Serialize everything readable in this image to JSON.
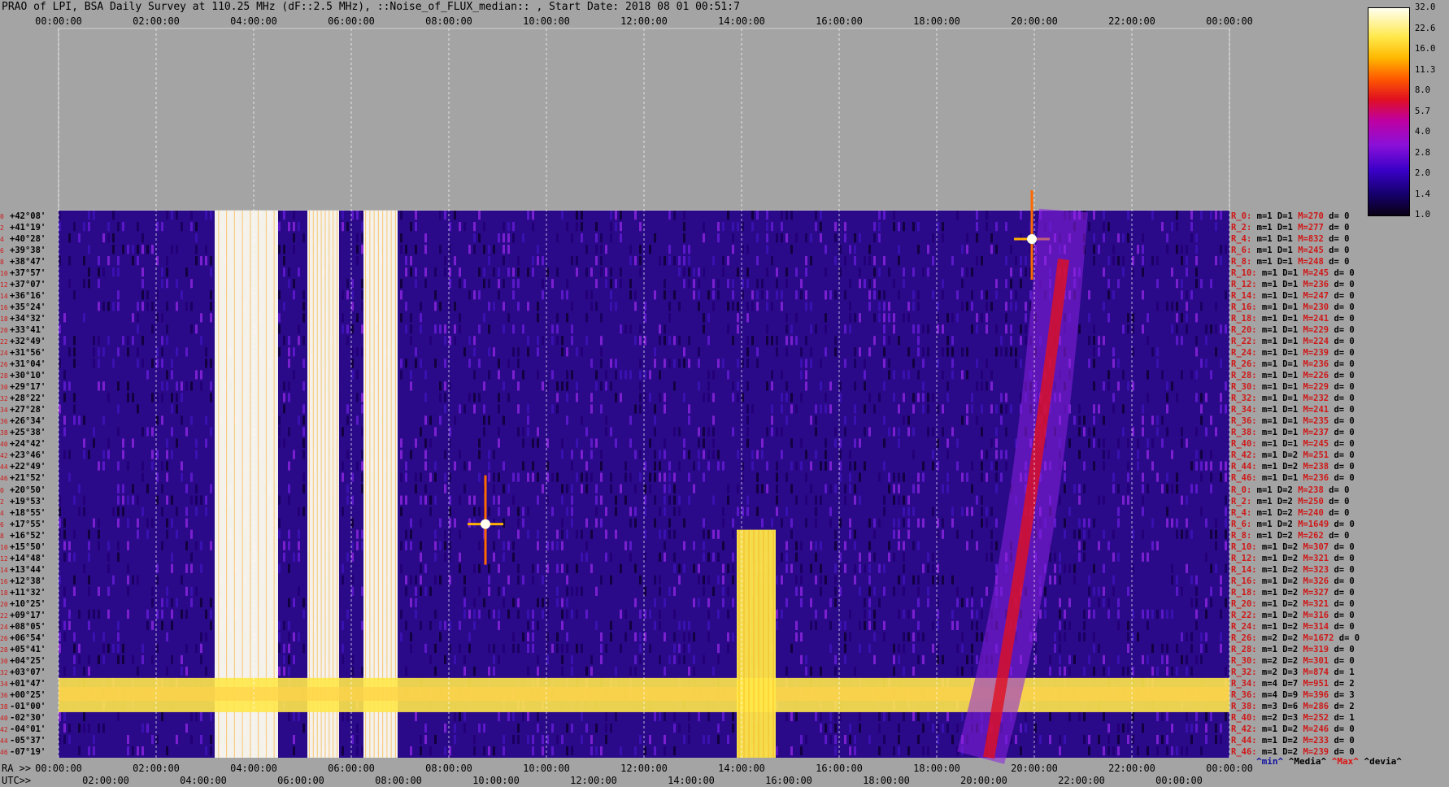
{
  "title": "PRAO of LPI, BSA Daily Survey at 110.25 MHz (dF::2.5 MHz), ::Noise_of_FLUX_median:: , Start Date: 2018 08 01 00:51:7",
  "chart_data": {
    "type": "heatmap",
    "title": "PRAO of LPI, BSA Daily Survey at 110.25 MHz (dF::2.5 MHz), ::Noise_of_FLUX_median:: , Start Date: 2018 08 01 00:51:7",
    "x_top_ticks": [
      "00:00:00",
      "02:00:00",
      "04:00:00",
      "06:00:00",
      "08:00:00",
      "10:00:00",
      "12:00:00",
      "14:00:00",
      "16:00:00",
      "18:00:00",
      "20:00:00",
      "22:00:00",
      "00:00:00"
    ],
    "x_ra_ticks": [
      "00:00:00",
      "02:00:00",
      "04:00:00",
      "06:00:00",
      "08:00:00",
      "10:00:00",
      "12:00:00",
      "14:00:00",
      "16:00:00",
      "18:00:00",
      "20:00:00",
      "22:00:00",
      "00:00:00"
    ],
    "x_utc_ticks": [
      "02:00:00",
      "04:00:00",
      "06:00:00",
      "08:00:00",
      "10:00:00",
      "12:00:00",
      "14:00:00",
      "16:00:00",
      "18:00:00",
      "20:00:00",
      "22:00:00",
      "00:00:00"
    ],
    "x_ra_prefix": "RA >>",
    "x_utc_prefix": "UTC>>",
    "dec_labels": [
      "+42°08'",
      "+41°19'",
      "+40°28'",
      "+39°38'",
      "+38°47'",
      "+37°57'",
      "+37°07'",
      "+36°16'",
      "+35°24'",
      "+34°32'",
      "+33°41'",
      "+32°49'",
      "+31°56'",
      "+31°04'",
      "+30°10'",
      "+29°17'",
      "+28°22'",
      "+27°28'",
      "+26°34'",
      "+25°38'",
      "+24°42'",
      "+23°46'",
      "+22°49'",
      "+21°52'",
      "+20°50'",
      "+19°53'",
      "+18°55'",
      "+17°55'",
      "+16°52'",
      "+15°50'",
      "+14°48'",
      "+13°44'",
      "+12°38'",
      "+11°32'",
      "+10°25'",
      "+09°17'",
      "+08°05'",
      "+06°54'",
      "+05°41'",
      "+04°25'",
      "+03°07'",
      "+01°47'",
      "+00°25'",
      "-01°00'",
      "-02°30'",
      "-04°01'",
      "-05°37'",
      "-07°19'"
    ],
    "dec_index_labels": [
      "0",
      "2",
      "4",
      "6",
      "8",
      "10",
      "12",
      "14",
      "16",
      "18",
      "20",
      "22",
      "24",
      "26",
      "28",
      "30",
      "32",
      "34",
      "36",
      "38",
      "40",
      "42",
      "44",
      "46",
      "0",
      "2",
      "4",
      "6",
      "8",
      "10",
      "12",
      "14",
      "16",
      "18",
      "20",
      "22",
      "24",
      "26",
      "28",
      "30",
      "32",
      "34",
      "36",
      "38",
      "40",
      "42",
      "44",
      "46"
    ],
    "colorbar": {
      "ticks": [
        "32.0",
        "22.6",
        "16.0",
        "11.3",
        "8.0",
        "5.7",
        "4.0",
        "2.8",
        "2.0",
        "1.4",
        "1.0"
      ],
      "colors": [
        "#0a0014",
        "#14006a",
        "#3a00c8",
        "#8a10d8",
        "#c000a0",
        "#e01020",
        "#ff5a00",
        "#ffb800",
        "#ffe84a",
        "#fffff0"
      ]
    },
    "features": [
      {
        "type": "vertical_band",
        "ra_start_h": 3.2,
        "ra_end_h": 4.5,
        "level": 22.6
      },
      {
        "type": "vertical_band",
        "ra_start_h": 5.1,
        "ra_end_h": 5.75,
        "level": 32.0
      },
      {
        "type": "vertical_band",
        "ra_start_h": 6.25,
        "ra_end_h": 6.95,
        "level": 22.6
      },
      {
        "type": "horizontal_band",
        "dec_start_idx": 41,
        "dec_end_idx": 43,
        "level": 16.0
      },
      {
        "type": "vertical_band",
        "ra_start_h": 13.9,
        "ra_end_h": 14.7,
        "dec_start_idx": 28,
        "dec_end_idx": 47,
        "level": 16.0
      },
      {
        "type": "source",
        "ra_h": 8.75,
        "dec_idx": 27,
        "level": 32.0
      },
      {
        "type": "source",
        "ra_h": 19.95,
        "dec_idx": 2,
        "level": 32.0
      },
      {
        "type": "diffuse_arc",
        "ra_start_h": 20.6,
        "ra_end_h": 18.9,
        "level": 5.7
      }
    ]
  },
  "stats_rows": [
    {
      "name": "R_0:",
      "m": "m=1",
      "D": "D=1",
      "M": "M=270",
      "d": "d= 0"
    },
    {
      "name": "R_2:",
      "m": "m=1",
      "D": "D=1",
      "M": "M=277",
      "d": "d= 0"
    },
    {
      "name": "R_4:",
      "m": "m=1",
      "D": "D=1",
      "M": "M=832",
      "d": "d= 0"
    },
    {
      "name": "R_6:",
      "m": "m=1",
      "D": "D=1",
      "M": "M=245",
      "d": "d= 0"
    },
    {
      "name": "R_8:",
      "m": "m=1",
      "D": "D=1",
      "M": "M=248",
      "d": "d= 0"
    },
    {
      "name": "R_10:",
      "m": "m=1",
      "D": "D=1",
      "M": "M=245",
      "d": "d= 0"
    },
    {
      "name": "R_12:",
      "m": "m=1",
      "D": "D=1",
      "M": "M=236",
      "d": "d= 0"
    },
    {
      "name": "R_14:",
      "m": "m=1",
      "D": "D=1",
      "M": "M=247",
      "d": "d= 0"
    },
    {
      "name": "R_16:",
      "m": "m=1",
      "D": "D=1",
      "M": "M=230",
      "d": "d= 0"
    },
    {
      "name": "R_18:",
      "m": "m=1",
      "D": "D=1",
      "M": "M=241",
      "d": "d= 0"
    },
    {
      "name": "R_20:",
      "m": "m=1",
      "D": "D=1",
      "M": "M=229",
      "d": "d= 0"
    },
    {
      "name": "R_22:",
      "m": "m=1",
      "D": "D=1",
      "M": "M=224",
      "d": "d= 0"
    },
    {
      "name": "R_24:",
      "m": "m=1",
      "D": "D=1",
      "M": "M=239",
      "d": "d= 0"
    },
    {
      "name": "R_26:",
      "m": "m=1",
      "D": "D=1",
      "M": "M=236",
      "d": "d= 0"
    },
    {
      "name": "R_28:",
      "m": "m=1",
      "D": "D=1",
      "M": "M=226",
      "d": "d= 0"
    },
    {
      "name": "R_30:",
      "m": "m=1",
      "D": "D=1",
      "M": "M=229",
      "d": "d= 0"
    },
    {
      "name": "R_32:",
      "m": "m=1",
      "D": "D=1",
      "M": "M=232",
      "d": "d= 0"
    },
    {
      "name": "R_34:",
      "m": "m=1",
      "D": "D=1",
      "M": "M=241",
      "d": "d= 0"
    },
    {
      "name": "R_36:",
      "m": "m=1",
      "D": "D=1",
      "M": "M=235",
      "d": "d= 0"
    },
    {
      "name": "R_38:",
      "m": "m=1",
      "D": "D=1",
      "M": "M=237",
      "d": "d= 0"
    },
    {
      "name": "R_40:",
      "m": "m=1",
      "D": "D=1",
      "M": "M=245",
      "d": "d= 0"
    },
    {
      "name": "R_42:",
      "m": "m=1",
      "D": "D=2",
      "M": "M=251",
      "d": "d= 0"
    },
    {
      "name": "R_44:",
      "m": "m=1",
      "D": "D=2",
      "M": "M=238",
      "d": "d= 0"
    },
    {
      "name": "R_46:",
      "m": "m=1",
      "D": "D=1",
      "M": "M=236",
      "d": "d= 0"
    },
    {
      "name": "R_0:",
      "m": "m=1",
      "D": "D=2",
      "M": "M=238",
      "d": "d= 0"
    },
    {
      "name": "R_2:",
      "m": "m=1",
      "D": "D=2",
      "M": "M=250",
      "d": "d= 0"
    },
    {
      "name": "R_4:",
      "m": "m=1",
      "D": "D=2",
      "M": "M=240",
      "d": "d= 0"
    },
    {
      "name": "R_6:",
      "m": "m=1",
      "D": "D=2",
      "M": "M=1649",
      "d": "d= 0"
    },
    {
      "name": "R_8:",
      "m": "m=1",
      "D": "D=2",
      "M": "M=262",
      "d": "d= 0"
    },
    {
      "name": "R_10:",
      "m": "m=1",
      "D": "D=2",
      "M": "M=307",
      "d": "d= 0"
    },
    {
      "name": "R_12:",
      "m": "m=1",
      "D": "D=2",
      "M": "M=321",
      "d": "d= 0"
    },
    {
      "name": "R_14:",
      "m": "m=1",
      "D": "D=2",
      "M": "M=323",
      "d": "d= 0"
    },
    {
      "name": "R_16:",
      "m": "m=1",
      "D": "D=2",
      "M": "M=326",
      "d": "d= 0"
    },
    {
      "name": "R_18:",
      "m": "m=1",
      "D": "D=2",
      "M": "M=327",
      "d": "d= 0"
    },
    {
      "name": "R_20:",
      "m": "m=1",
      "D": "D=2",
      "M": "M=321",
      "d": "d= 0"
    },
    {
      "name": "R_22:",
      "m": "m=1",
      "D": "D=2",
      "M": "M=316",
      "d": "d= 0"
    },
    {
      "name": "R_24:",
      "m": "m=1",
      "D": "D=2",
      "M": "M=314",
      "d": "d= 0"
    },
    {
      "name": "R_26:",
      "m": "m=2",
      "D": "D=2",
      "M": "M=1672",
      "d": "d= 0"
    },
    {
      "name": "R_28:",
      "m": "m=1",
      "D": "D=2",
      "M": "M=319",
      "d": "d= 0"
    },
    {
      "name": "R_30:",
      "m": "m=2",
      "D": "D=2",
      "M": "M=301",
      "d": "d= 0"
    },
    {
      "name": "R_32:",
      "m": "m=2",
      "D": "D=3",
      "M": "M=874",
      "d": "d= 1"
    },
    {
      "name": "R_34:",
      "m": "m=4",
      "D": "D=7",
      "M": "M=951",
      "d": "d= 2"
    },
    {
      "name": "R_36:",
      "m": "m=4",
      "D": "D=9",
      "M": "M=396",
      "d": "d= 3"
    },
    {
      "name": "R_38:",
      "m": "m=3",
      "D": "D=6",
      "M": "M=286",
      "d": "d= 2"
    },
    {
      "name": "R_40:",
      "m": "m=2",
      "D": "D=3",
      "M": "M=252",
      "d": "d= 1"
    },
    {
      "name": "R_42:",
      "m": "m=1",
      "D": "D=2",
      "M": "M=246",
      "d": "d= 0"
    },
    {
      "name": "R_44:",
      "m": "m=1",
      "D": "D=2",
      "M": "M=233",
      "d": "d= 0"
    },
    {
      "name": "R_46:",
      "m": "m=1",
      "D": "D=2",
      "M": "M=239",
      "d": "d= 0"
    }
  ],
  "legend": {
    "min": "^min^",
    "median": "^Media^",
    "max": "^Max^",
    "dev": "^devia^"
  }
}
